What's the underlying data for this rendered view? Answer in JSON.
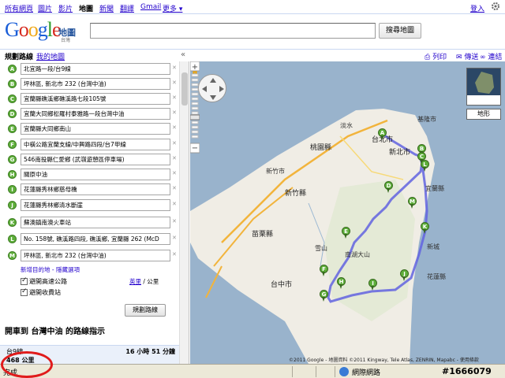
{
  "topnav": {
    "items": [
      "所有網頁",
      "圖片",
      "影片",
      "地圖",
      "新聞",
      "翻譯",
      "Gmail",
      "更多 ▾"
    ],
    "signin": "登入"
  },
  "header": {
    "logo": "Google",
    "product": "地圖",
    "region": "台灣",
    "search_value": "",
    "search_button": "搜尋地圖"
  },
  "toolbar": {
    "tab_directions": "規劃路線",
    "tab_mymaps": "我的地圖",
    "collapse": "«",
    "print": "列印",
    "send": "傳送",
    "link": "連結"
  },
  "waypoints": [
    {
      "letter": "A",
      "text": "北宜路一段/台9線"
    },
    {
      "letter": "B",
      "text": "坪林區, 新北市 232 (台灣中油)"
    },
    {
      "letter": "C",
      "text": "宜蘭縣礁溪鄉礁溪路七段105號"
    },
    {
      "letter": "D",
      "text": "宜蘭大同鄉松羅村泰雅路一段台灣中油"
    },
    {
      "letter": "E",
      "text": "宜蘭縣大同鄉南山"
    },
    {
      "letter": "F",
      "text": "中橫公路宜蘭支線/中興路四段/台7甲線"
    },
    {
      "letter": "G",
      "text": "546南投縣仁愛鄉 (武嶺遊憩區停車場)"
    },
    {
      "letter": "H",
      "text": "關原中油"
    },
    {
      "letter": "I",
      "text": "花蓮縣秀林鄉慈母橋"
    },
    {
      "letter": "J",
      "text": "花蓮縣秀林鄉清水斷崖"
    },
    {
      "letter": "K",
      "text": "蘇澳鎮南澳火車站"
    },
    {
      "letter": "L",
      "text": "No. 158號, 礁溪路四段, 礁溪鄉, 宜蘭縣 262 (McD"
    },
    {
      "letter": "M",
      "text": "坪林區, 新北市 232 (台灣中油)"
    }
  ],
  "add_destination": "新增目的地 - 隱藏選項",
  "units": {
    "miles": "英里",
    "sep": " / ",
    "km": "公里"
  },
  "options": {
    "avoid_highways": "避開高速公路",
    "avoid_tolls": "避開收費站"
  },
  "route_button": "規劃路線",
  "directions_title": "開車到 台灣中油 的路線指示",
  "summary": {
    "route": "台9線",
    "time": "16 小時 51 分鐘",
    "distance": "468 公里"
  },
  "map": {
    "satellite": "衛星",
    "terrain": "地形",
    "copyright": "©2011 Google - 地圖資料 ©2011 Kingway, Tele Atlas, ZENRIN, Mapabc - 使用條款",
    "labels": [
      {
        "text": "淡水",
        "cls": ""
      },
      {
        "text": "台北市",
        "cls": "big"
      },
      {
        "text": "基隆市",
        "cls": ""
      },
      {
        "text": "新北市",
        "cls": "big"
      },
      {
        "text": "桃園縣",
        "cls": "big"
      },
      {
        "text": "新竹市",
        "cls": ""
      },
      {
        "text": "新竹縣",
        "cls": "big"
      },
      {
        "text": "宜蘭縣",
        "cls": ""
      },
      {
        "text": "苗栗縣",
        "cls": "big"
      },
      {
        "text": "雪山",
        "cls": ""
      },
      {
        "text": "南湖大山",
        "cls": ""
      },
      {
        "text": "台中市",
        "cls": "big"
      },
      {
        "text": "花蓮縣",
        "cls": ""
      },
      {
        "text": "新城",
        "cls": ""
      }
    ],
    "pins": [
      "A",
      "B",
      "C",
      "D",
      "E",
      "F",
      "G",
      "H",
      "I",
      "J",
      "K",
      "L",
      "M"
    ]
  },
  "status": {
    "text": "完成",
    "zone": "網際網路",
    "watermark": "#1666079"
  }
}
